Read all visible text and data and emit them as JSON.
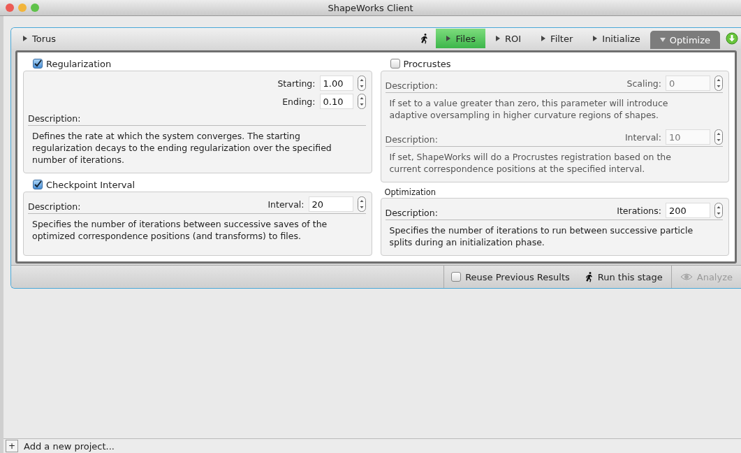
{
  "window": {
    "title": "ShapeWorks Client"
  },
  "project": {
    "name": "Torus",
    "expanded": false,
    "stages": [
      {
        "label": "Files",
        "selected": false,
        "completed": true
      },
      {
        "label": "ROI",
        "selected": false,
        "completed": false
      },
      {
        "label": "Filter",
        "selected": false,
        "completed": false
      },
      {
        "label": "Initialize",
        "selected": false,
        "completed": false
      },
      {
        "label": "Optimize",
        "selected": true,
        "completed": false
      }
    ],
    "columns": [
      [
        {
          "kind": "checkbox",
          "title": "Regularization",
          "checked": true,
          "blocks": [
            {
              "params": [
                {
                  "label": "Starting:",
                  "value": "1.00"
                },
                {
                  "label": "Ending:",
                  "value": "0.10"
                }
              ],
              "description_label": "Description:",
              "description": "Defines the rate at which the system converges. The starting regularization decays to the ending regularization over the specified number of iterations.",
              "disabled": false
            }
          ]
        },
        {
          "kind": "checkbox",
          "title": "Checkpoint Interval",
          "checked": true,
          "blocks": [
            {
              "params": [
                {
                  "label": "Interval:",
                  "value": "20"
                }
              ],
              "description_label": "Description:",
              "description": "Specifies the number of iterations between successive saves of the optimized correspondence positions (and transforms) to files.",
              "disabled": false
            }
          ]
        }
      ],
      [
        {
          "kind": "checkbox",
          "title": "Procrustes",
          "checked": false,
          "blocks": [
            {
              "params": [
                {
                  "label": "Scaling:",
                  "value": "0"
                }
              ],
              "description_label": "Description:",
              "description": "If set to a value greater than zero, this parameter will introduce adaptive oversampling in higher curvature regions of shapes.",
              "disabled": true
            },
            {
              "params": [
                {
                  "label": "Interval:",
                  "value": "10"
                }
              ],
              "description_label": "Description:",
              "description": "If set, ShapeWorks will do a Procrustes registration based on the current correspondence positions at the specified interval.",
              "disabled": true
            }
          ]
        },
        {
          "kind": "label",
          "title": "Optimization",
          "blocks": [
            {
              "params": [
                {
                  "label": "Iterations:",
                  "value": "200"
                }
              ],
              "description_label": "Description:",
              "description": "Specifies the number of iterations to run between successive particle splits during an initialization phase.",
              "disabled": false
            }
          ]
        }
      ]
    ],
    "reuse": {
      "label": "Reuse Previous Results",
      "checked": false
    },
    "run_button": "Run this stage",
    "analyze_button": {
      "label": "Analyze",
      "disabled": true
    }
  },
  "footer": {
    "add_button": "+",
    "label": "Add a new project..."
  }
}
